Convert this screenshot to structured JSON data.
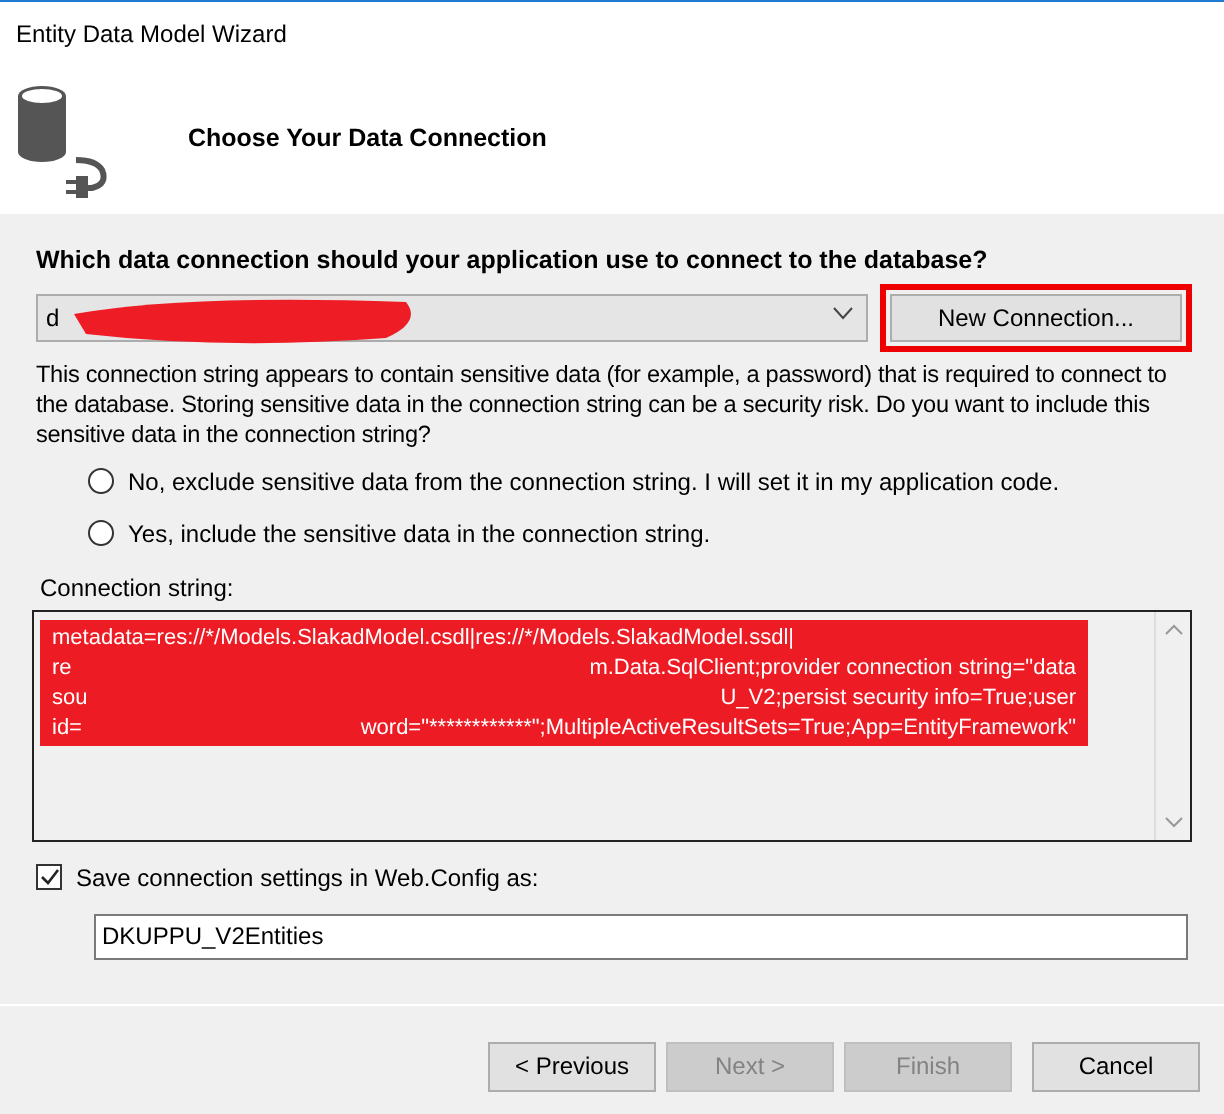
{
  "window": {
    "title": "Entity Data Model Wizard"
  },
  "header": {
    "title": "Choose Your Data Connection"
  },
  "question": "Which data connection should your application use to connect to the database?",
  "connection": {
    "value": "d",
    "redacted": true
  },
  "new_connection_button": {
    "label": "New Connection...",
    "highlighted": true
  },
  "warning": "This connection string appears to contain sensitive data (for example, a password) that is required to connect to the database. Storing sensitive data in the connection string can be a security risk. Do you want to include this sensitive data in the connection string?",
  "options": [
    {
      "label": "No, exclude sensitive data from the connection string. I will set it in my application code.",
      "selected": false
    },
    {
      "label": "Yes, include the sensitive data in the connection string.",
      "selected": false
    }
  ],
  "connection_string": {
    "label": "Connection string:",
    "redacted": true,
    "lines": [
      {
        "lead": "metadata=res://*/Models.SlakadModel.csdl|res://*/Models.SlakadModel.ssdl|"
      },
      {
        "lead": "re",
        "tail": "m.Data.SqlClient;provider connection string=\"data"
      },
      {
        "lead": "sou",
        "tail": "U_V2;persist security info=True;user"
      },
      {
        "lead": "id=",
        "tail": "word=\"************\";MultipleActiveResultSets=True;App=EntityFramework\""
      }
    ]
  },
  "save_settings": {
    "label": "Save connection settings in Web.Config as:",
    "checked": true,
    "value": "DKUPPU_V2Entities"
  },
  "buttons": [
    {
      "label": "< Previous",
      "disabled": false
    },
    {
      "label": "Next >",
      "disabled": true
    },
    {
      "label": "Finish",
      "disabled": true
    },
    {
      "label": "Cancel",
      "disabled": false
    }
  ]
}
